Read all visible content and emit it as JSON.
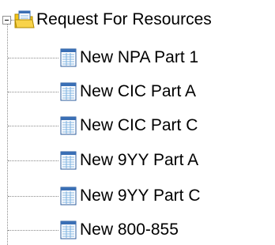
{
  "tree": {
    "root": {
      "label": "Request For Resources",
      "expanded": true,
      "icon": "folder-document-icon"
    },
    "items": [
      {
        "label": "New NPA Part 1",
        "icon": "form-document-icon"
      },
      {
        "label": "New CIC Part A",
        "icon": "form-document-icon"
      },
      {
        "label": "New CIC Part C",
        "icon": "form-document-icon"
      },
      {
        "label": "New 9YY Part A",
        "icon": "form-document-icon"
      },
      {
        "label": "New 9YY Part C",
        "icon": "form-document-icon"
      },
      {
        "label": "New 800-855",
        "icon": "form-document-icon"
      }
    ]
  },
  "colors": {
    "folder": "#f5c518",
    "document_header": "#3a6fb5",
    "document_grid": "#7fb3e0",
    "tree_lines": "#8a8a8a"
  }
}
